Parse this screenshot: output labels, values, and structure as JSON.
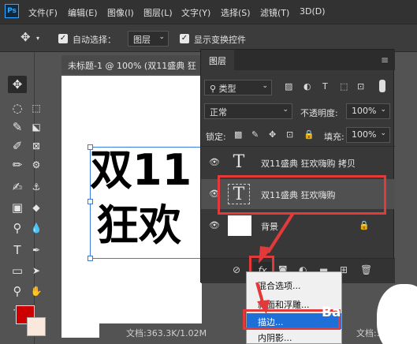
{
  "app": {
    "logo": "Ps"
  },
  "menu": [
    "文件(F)",
    "编辑(E)",
    "图像(I)",
    "图层(L)",
    "文字(Y)",
    "选择(S)",
    "滤镜(T)",
    "3D(D)"
  ],
  "options": {
    "move_icon": "move-icon",
    "auto_select_label": "自动选择：",
    "auto_select_target": "图层",
    "show_transform_label": "显示变换控件"
  },
  "document": {
    "tab_title": "未标题-1 @ 100% (双11盛典 狂",
    "canvas_line1": "双11",
    "canvas_line2": "狂欢",
    "status_left": "文档:363.3K/1.02M",
    "status_right": "文档:363.3"
  },
  "layers_panel": {
    "title": "图层",
    "filter_label": "类型",
    "blend_mode": "正常",
    "opacity_label": "不透明度:",
    "opacity_value": "100%",
    "lock_label": "锁定:",
    "fill_label": "填充:",
    "fill_value": "100%",
    "layers": [
      {
        "name": "双11盛典 狂欢嗨购 拷贝",
        "type": "text"
      },
      {
        "name": "双11盛典 狂欢嗨购",
        "type": "text"
      },
      {
        "name": "背景",
        "type": "background"
      }
    ],
    "fx_label": "fx"
  },
  "fx_menu": [
    "混合选项...",
    "斜面和浮雕...",
    "描边...",
    "内阴影..."
  ],
  "watermark": "Ba",
  "colors": {
    "foreground": "#cc0000",
    "background": "#fbe8dc",
    "highlight_box": "#e23a3a",
    "menu_selected": "#1e6fd8"
  }
}
